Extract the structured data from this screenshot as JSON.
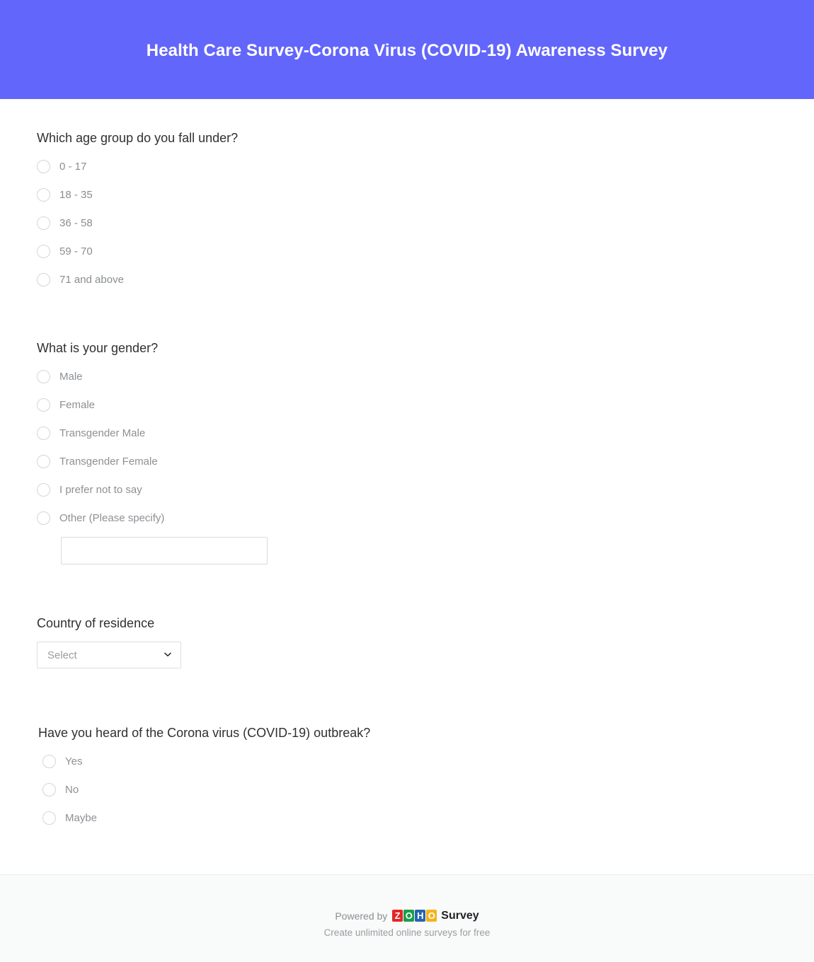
{
  "header": {
    "title": "Health Care Survey-Corona Virus (COVID-19) Awareness Survey",
    "background_color": "#6366fb",
    "text_color": "#ffffff"
  },
  "questions": [
    {
      "id": "age-group",
      "title": "Which age group do you fall under?",
      "type": "radio",
      "options": [
        {
          "label": "0 - 17"
        },
        {
          "label": "18 - 35"
        },
        {
          "label": "36 - 58"
        },
        {
          "label": "59 - 70"
        },
        {
          "label": "71 and above"
        }
      ]
    },
    {
      "id": "gender",
      "title": "What is your gender?",
      "type": "radio",
      "options": [
        {
          "label": "Male"
        },
        {
          "label": "Female"
        },
        {
          "label": "Transgender Male"
        },
        {
          "label": "Transgender Female"
        },
        {
          "label": "I prefer not to say"
        },
        {
          "label": "Other (Please specify)"
        }
      ],
      "other_input": {
        "value": "",
        "placeholder": ""
      }
    },
    {
      "id": "country-of-residence",
      "title": "Country of residence",
      "type": "select",
      "select": {
        "selected": "Select",
        "icon": "chevron-down-icon"
      }
    },
    {
      "id": "heard-of-covid",
      "title": "Have you heard of the Corona virus (COVID-19) outbreak?",
      "type": "radio",
      "options": [
        {
          "label": "Yes"
        },
        {
          "label": "No"
        },
        {
          "label": "Maybe"
        }
      ]
    }
  ],
  "footer": {
    "powered_by": "Powered by",
    "logo": {
      "letters": [
        "Z",
        "O",
        "H",
        "O"
      ],
      "colors": [
        "#e42527",
        "#1b9e47",
        "#2764b0",
        "#f6b21b"
      ]
    },
    "product": "Survey",
    "tagline": "Create unlimited online surveys for free"
  }
}
